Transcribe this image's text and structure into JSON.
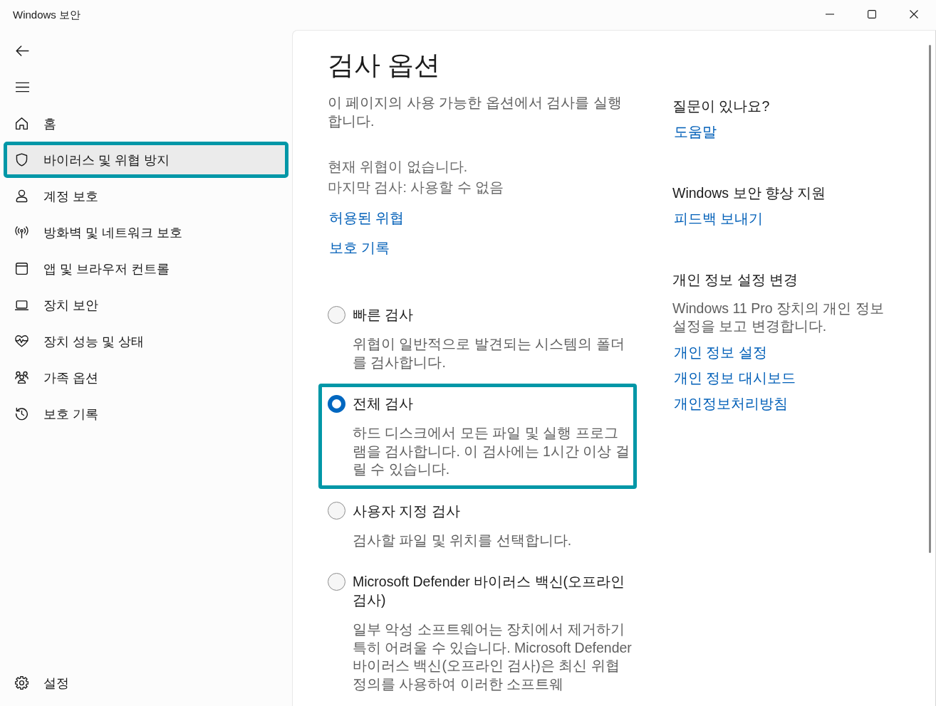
{
  "window": {
    "title": "Windows 보안"
  },
  "sidebar": {
    "items": [
      {
        "label": "홈",
        "selected": false,
        "highlighted": false
      },
      {
        "label": "바이러스 및 위협 방지",
        "selected": true,
        "highlighted": true
      },
      {
        "label": "계정 보호",
        "selected": false,
        "highlighted": false
      },
      {
        "label": "방화벽 및 네트워크 보호",
        "selected": false,
        "highlighted": false
      },
      {
        "label": "앱 및 브라우저 컨트롤",
        "selected": false,
        "highlighted": false
      },
      {
        "label": "장치 보안",
        "selected": false,
        "highlighted": false
      },
      {
        "label": "장치 성능 및 상태",
        "selected": false,
        "highlighted": false
      },
      {
        "label": "가족 옵션",
        "selected": false,
        "highlighted": false
      },
      {
        "label": "보호 기록",
        "selected": false,
        "highlighted": false
      }
    ],
    "settings": {
      "label": "설정"
    }
  },
  "main": {
    "title": "검사 옵션",
    "description": "이 페이지의 사용 가능한 옵션에서 검사를 실행합니다.",
    "status_lines": [
      "현재 위협이 없습니다.",
      "마지막 검사: 사용할 수 없음"
    ],
    "links": [
      "허용된 위협",
      "보호 기록"
    ],
    "scan_options": [
      {
        "label": "빠른 검사",
        "description": "위협이 일반적으로 발견되는 시스템의 폴더를 검사합니다.",
        "selected": false,
        "highlighted": false
      },
      {
        "label": "전체 검사",
        "description": "하드 디스크에서 모든 파일 및 실행 프로그램을 검사합니다. 이 검사에는 1시간 이상 걸릴 수 있습니다.",
        "selected": true,
        "highlighted": true
      },
      {
        "label": "사용자 지정 검사",
        "description": "검사할 파일 및 위치를 선택합니다.",
        "selected": false,
        "highlighted": false
      },
      {
        "label": "Microsoft Defender 바이러스 백신(오프라인 검사)",
        "description": "일부 악성 소프트웨어는 장치에서 제거하기 특히 어려울 수 있습니다. Microsoft Defender 바이러스 백신(오프라인 검사)은 최신 위협 정의를 사용하여 이러한 소프트웨",
        "selected": false,
        "highlighted": false
      }
    ]
  },
  "side_panel": {
    "sections": [
      {
        "heading": "질문이 있나요?",
        "links": [
          "도움말"
        ]
      },
      {
        "heading": "Windows 보안 향상 지원",
        "links": [
          "피드백 보내기"
        ]
      },
      {
        "heading": "개인 정보 설정 변경",
        "description": "Windows 11 Pro 장치의 개인 정보 설정을 보고 변경합니다.",
        "links": [
          "개인 정보 설정",
          "개인 정보 대시보드",
          "개인정보처리방침"
        ]
      }
    ]
  }
}
